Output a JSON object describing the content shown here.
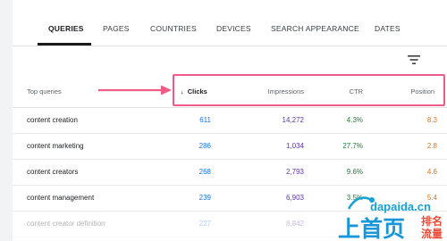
{
  "tabs": [
    {
      "label": "QUERIES",
      "active": true
    },
    {
      "label": "PAGES",
      "active": false
    },
    {
      "label": "COUNTRIES",
      "active": false
    },
    {
      "label": "DEVICES",
      "active": false
    },
    {
      "label": "SEARCH APPEARANCE",
      "active": false
    },
    {
      "label": "DATES",
      "active": false
    }
  ],
  "filter_icon": "filter-icon",
  "table": {
    "headers": {
      "query": "Top queries",
      "clicks": "Clicks",
      "impressions": "Impressions",
      "ctr": "CTR",
      "position": "Position"
    },
    "sort_icon": "arrow-down-icon",
    "rows": [
      {
        "query": "content creation",
        "clicks": "611",
        "impressions": "14,272",
        "ctr": "4.3%",
        "position": "8.3"
      },
      {
        "query": "content marketing",
        "clicks": "286",
        "impressions": "1,034",
        "ctr": "27.7%",
        "position": "2.8"
      },
      {
        "query": "content creators",
        "clicks": "268",
        "impressions": "2,793",
        "ctr": "9.6%",
        "position": "4.6"
      },
      {
        "query": "content management",
        "clicks": "239",
        "impressions": "6,903",
        "ctr": "3.5%",
        "position": "5.4"
      },
      {
        "query": "content creator definition",
        "clicks": "227",
        "impressions": "8,842",
        "ctr": "",
        "position": ""
      }
    ]
  },
  "watermark": {
    "domain": "dapaida.cn",
    "text_main": "上首页",
    "text_side_1": "排名",
    "text_side_2": "流量"
  },
  "colors": {
    "clicks": "#1a73e8",
    "impressions": "#5e35b1",
    "ctr": "#188038",
    "position": "#e8710a",
    "highlight": "#ef5b86"
  }
}
